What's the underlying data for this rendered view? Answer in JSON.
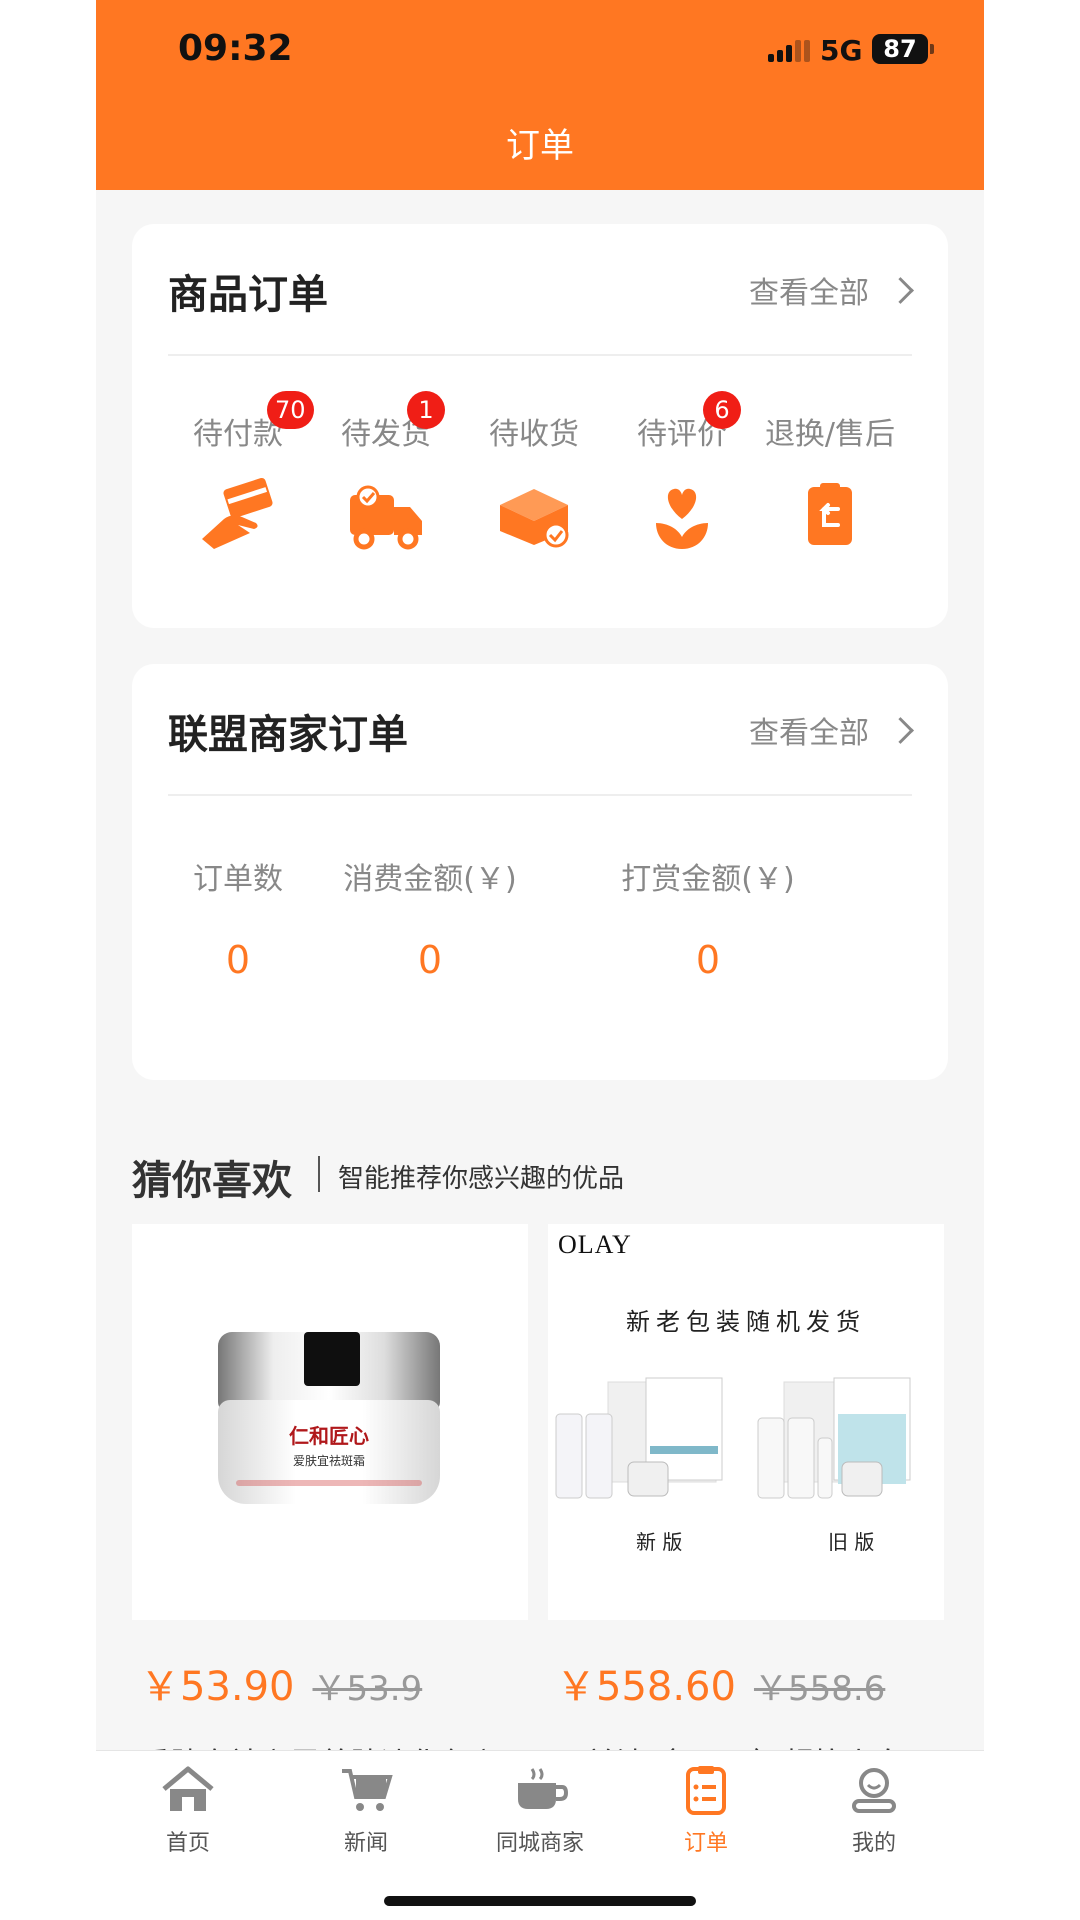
{
  "status_bar": {
    "time": "09:32",
    "network": "5G",
    "battery": "87"
  },
  "nav": {
    "title": "订单"
  },
  "goods_orders": {
    "title": "商品订单",
    "view_all": "查看全部",
    "statuses": [
      {
        "label": "待付款",
        "badge": "70",
        "icon": "card-payment-icon"
      },
      {
        "label": "待发货",
        "badge": "1",
        "icon": "delivery-truck-icon"
      },
      {
        "label": "待收货",
        "badge": "",
        "icon": "package-box-icon"
      },
      {
        "label": "待评价",
        "badge": "6",
        "icon": "heart-flower-icon"
      },
      {
        "label": "退换/售后",
        "badge": "",
        "icon": "return-bag-icon"
      }
    ]
  },
  "alliance_orders": {
    "title": "联盟商家订单",
    "view_all": "查看全部",
    "stats": [
      {
        "label": "订单数",
        "value": "0"
      },
      {
        "label": "消费金额(￥)",
        "value": "0"
      },
      {
        "label": "打赏金额(￥)",
        "value": "0"
      }
    ]
  },
  "recommend": {
    "title": "猜你喜欢",
    "subtitle": "智能推荐你感兴趣的优品",
    "products": [
      {
        "price": "￥53.90",
        "original_price": "￥53.9",
        "name": "爱肤宜祛斑霜养肤淡化色斑",
        "image_text": {
          "brand": "仁和匠心",
          "product": "爱肤宜祛斑霜"
        }
      },
      {
        "price": "￥558.60",
        "original_price": "￥558.6",
        "name": "玉兰油（OLAY）超抗小白",
        "image_text": {
          "logo": "OLAY",
          "caption": "新老包装随机发货",
          "new_label": "新 版",
          "old_label": "旧 版"
        }
      }
    ]
  },
  "tabbar": {
    "tabs": [
      {
        "label": "首页",
        "icon": "home-icon"
      },
      {
        "label": "新闻",
        "icon": "cart-icon"
      },
      {
        "label": "同城商家",
        "icon": "coffee-cup-icon"
      },
      {
        "label": "订单",
        "icon": "order-list-icon",
        "active": true
      },
      {
        "label": "我的",
        "icon": "profile-icon"
      }
    ]
  },
  "colors": {
    "accent": "#ff7722",
    "badge": "#f01e16",
    "background": "#f6f6f6"
  }
}
